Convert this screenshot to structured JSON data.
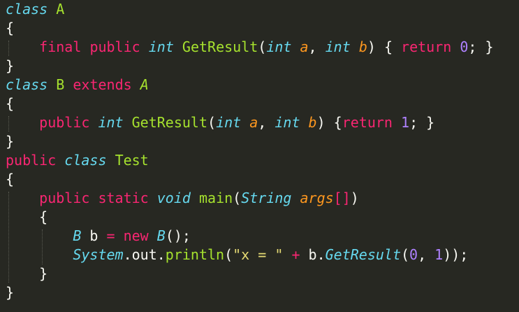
{
  "theme": {
    "background": "#272822",
    "foreground": "#f8f8f2",
    "keyword": "#f92672",
    "storage_type": "#66d9ef",
    "class_name": "#a6e22e",
    "parameter": "#fd971f",
    "number": "#ae81ff",
    "string": "#e6db74"
  },
  "code": {
    "lines": [
      [
        {
          "t": "class",
          "k": "storage"
        },
        {
          "t": " ",
          "k": "plain"
        },
        {
          "t": "A",
          "k": "classname"
        }
      ],
      [
        {
          "t": "{",
          "k": "punct"
        }
      ],
      [
        {
          "t": "    ",
          "k": "plain"
        },
        {
          "t": "final",
          "k": "keyword"
        },
        {
          "t": " ",
          "k": "plain"
        },
        {
          "t": "public",
          "k": "keyword"
        },
        {
          "t": " ",
          "k": "plain"
        },
        {
          "t": "int",
          "k": "storage"
        },
        {
          "t": " ",
          "k": "plain"
        },
        {
          "t": "GetResult",
          "k": "func"
        },
        {
          "t": "(",
          "k": "punct"
        },
        {
          "t": "int",
          "k": "storage"
        },
        {
          "t": " ",
          "k": "plain"
        },
        {
          "t": "a",
          "k": "param"
        },
        {
          "t": ", ",
          "k": "punct"
        },
        {
          "t": "int",
          "k": "storage"
        },
        {
          "t": " ",
          "k": "plain"
        },
        {
          "t": "b",
          "k": "param"
        },
        {
          "t": ") { ",
          "k": "punct"
        },
        {
          "t": "return",
          "k": "keyword"
        },
        {
          "t": " ",
          "k": "plain"
        },
        {
          "t": "0",
          "k": "number"
        },
        {
          "t": "; }",
          "k": "punct"
        }
      ],
      [
        {
          "t": "}",
          "k": "punct"
        }
      ],
      [
        {
          "t": "class",
          "k": "storage"
        },
        {
          "t": " ",
          "k": "plain"
        },
        {
          "t": "B",
          "k": "classname"
        },
        {
          "t": " ",
          "k": "plain"
        },
        {
          "t": "extends",
          "k": "keyword"
        },
        {
          "t": " ",
          "k": "plain"
        },
        {
          "t": "A",
          "k": "inherit"
        }
      ],
      [
        {
          "t": "{",
          "k": "punct"
        }
      ],
      [
        {
          "t": "    ",
          "k": "plain"
        },
        {
          "t": "public",
          "k": "keyword"
        },
        {
          "t": " ",
          "k": "plain"
        },
        {
          "t": "int",
          "k": "storage"
        },
        {
          "t": " ",
          "k": "plain"
        },
        {
          "t": "GetResult",
          "k": "func"
        },
        {
          "t": "(",
          "k": "punct"
        },
        {
          "t": "int",
          "k": "storage"
        },
        {
          "t": " ",
          "k": "plain"
        },
        {
          "t": "a",
          "k": "param"
        },
        {
          "t": ", ",
          "k": "punct"
        },
        {
          "t": "int",
          "k": "storage"
        },
        {
          "t": " ",
          "k": "plain"
        },
        {
          "t": "b",
          "k": "param"
        },
        {
          "t": ") {",
          "k": "punct"
        },
        {
          "t": "return",
          "k": "keyword"
        },
        {
          "t": " ",
          "k": "plain"
        },
        {
          "t": "1",
          "k": "number"
        },
        {
          "t": "; }",
          "k": "punct"
        }
      ],
      [
        {
          "t": "}",
          "k": "punct"
        }
      ],
      [
        {
          "t": "public",
          "k": "keyword"
        },
        {
          "t": " ",
          "k": "plain"
        },
        {
          "t": "class",
          "k": "storage"
        },
        {
          "t": " ",
          "k": "plain"
        },
        {
          "t": "Test",
          "k": "classname"
        }
      ],
      [
        {
          "t": "{",
          "k": "punct"
        }
      ],
      [
        {
          "t": "    ",
          "k": "plain"
        },
        {
          "t": "public",
          "k": "keyword"
        },
        {
          "t": " ",
          "k": "plain"
        },
        {
          "t": "static",
          "k": "keyword"
        },
        {
          "t": " ",
          "k": "plain"
        },
        {
          "t": "void",
          "k": "storage"
        },
        {
          "t": " ",
          "k": "plain"
        },
        {
          "t": "main",
          "k": "func"
        },
        {
          "t": "(",
          "k": "punct"
        },
        {
          "t": "String",
          "k": "support"
        },
        {
          "t": " ",
          "k": "plain"
        },
        {
          "t": "args",
          "k": "param"
        },
        {
          "t": "[]",
          "k": "keyword"
        },
        {
          "t": ")",
          "k": "punct"
        }
      ],
      [
        {
          "t": "    {",
          "k": "punct"
        }
      ],
      [
        {
          "t": "        ",
          "k": "plain"
        },
        {
          "t": "B",
          "k": "support"
        },
        {
          "t": " b ",
          "k": "plain"
        },
        {
          "t": "=",
          "k": "keyword"
        },
        {
          "t": " ",
          "k": "plain"
        },
        {
          "t": "new",
          "k": "keyword"
        },
        {
          "t": " ",
          "k": "plain"
        },
        {
          "t": "B",
          "k": "support"
        },
        {
          "t": "();",
          "k": "punct"
        }
      ],
      [
        {
          "t": "        ",
          "k": "plain"
        },
        {
          "t": "System",
          "k": "support"
        },
        {
          "t": ".out.",
          "k": "plain"
        },
        {
          "t": "println",
          "k": "func"
        },
        {
          "t": "(",
          "k": "punct"
        },
        {
          "t": "\"x = \"",
          "k": "string"
        },
        {
          "t": " ",
          "k": "plain"
        },
        {
          "t": "+",
          "k": "keyword"
        },
        {
          "t": " b.",
          "k": "plain"
        },
        {
          "t": "GetResult",
          "k": "support"
        },
        {
          "t": "(",
          "k": "punct"
        },
        {
          "t": "0",
          "k": "number"
        },
        {
          "t": ", ",
          "k": "punct"
        },
        {
          "t": "1",
          "k": "number"
        },
        {
          "t": "));",
          "k": "punct"
        }
      ],
      [
        {
          "t": "    }",
          "k": "punct"
        }
      ],
      [
        {
          "t": "}",
          "k": "punct"
        }
      ]
    ]
  }
}
